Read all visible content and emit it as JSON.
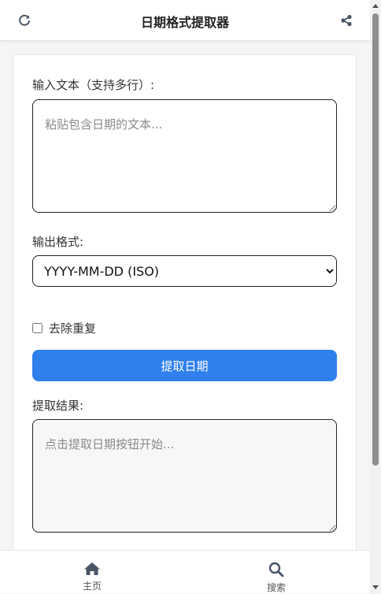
{
  "header": {
    "title": "日期格式提取器",
    "left_icon": "refresh-icon",
    "right_icon": "share-icon"
  },
  "form": {
    "input_label": "输入文本（支持多行）:",
    "input_placeholder": "粘贴包含日期的文本...",
    "format_label": "输出格式:",
    "format_selected": "YYYY-MM-DD (ISO)",
    "dedupe_label": "去除重复",
    "dedupe_checked": false,
    "extract_button": "提取日期",
    "result_label": "提取结果:",
    "result_placeholder": "点击提取日期按钮开始..."
  },
  "nav": {
    "items": [
      {
        "label": "主页",
        "icon": "home-icon"
      },
      {
        "label": "搜索",
        "icon": "search-icon"
      }
    ]
  },
  "colors": {
    "accent": "#2f80ed",
    "header_bg": "#ffffff",
    "page_bg": "#f4f5f7",
    "nav_icon": "#4a5568"
  }
}
